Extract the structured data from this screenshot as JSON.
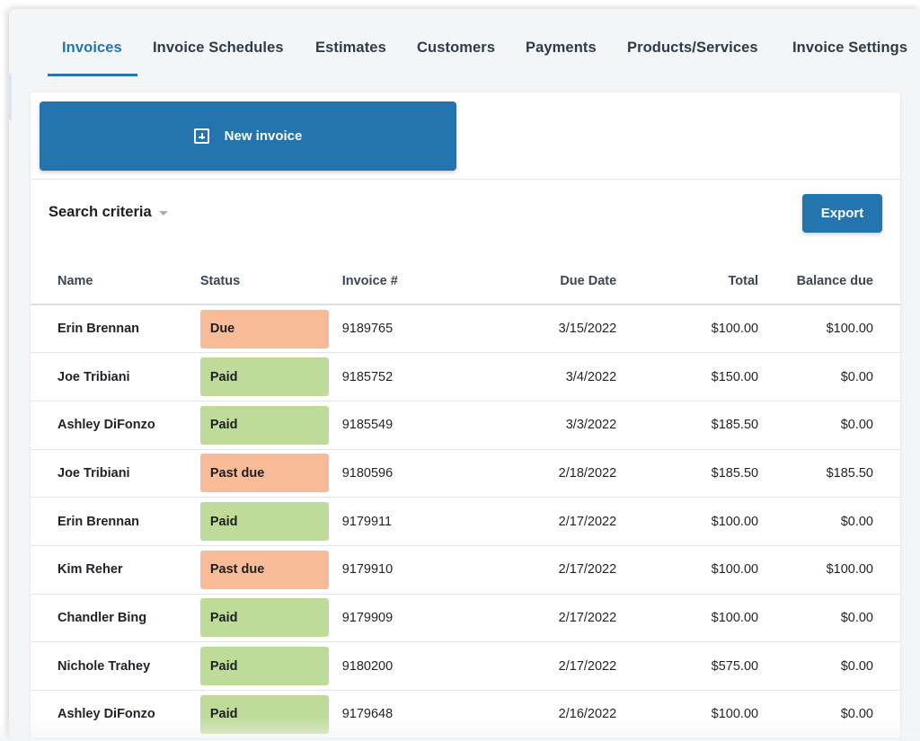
{
  "tabs": [
    {
      "label": "Invoices",
      "active": true
    },
    {
      "label": "Invoice Schedules",
      "active": false
    },
    {
      "label": "Estimates",
      "active": false
    },
    {
      "label": "Customers",
      "active": false
    },
    {
      "label": "Payments",
      "active": false
    },
    {
      "label": "Products/Services",
      "active": false
    },
    {
      "label": "Invoice Settings",
      "active": false
    }
  ],
  "actions": {
    "new_invoice_label": "New invoice",
    "search_criteria_label": "Search criteria",
    "export_label": "Export"
  },
  "colors": {
    "accent": "#2474b0",
    "status_due": "#f8bb98",
    "status_paid": "#bfdb9a"
  },
  "table": {
    "headers": {
      "name": "Name",
      "status": "Status",
      "invoice": "Invoice #",
      "due_date": "Due Date",
      "total": "Total",
      "balance_due": "Balance due"
    },
    "rows": [
      {
        "name": "Erin Brennan",
        "status": "Due",
        "invoice": "9189765",
        "due_date": "3/15/2022",
        "total": "$100.00",
        "balance_due": "$100.00"
      },
      {
        "name": "Joe Tribiani",
        "status": "Paid",
        "invoice": "9185752",
        "due_date": "3/4/2022",
        "total": "$150.00",
        "balance_due": "$0.00"
      },
      {
        "name": "Ashley DiFonzo",
        "status": "Paid",
        "invoice": "9185549",
        "due_date": "3/3/2022",
        "total": "$185.50",
        "balance_due": "$0.00"
      },
      {
        "name": "Joe Tribiani",
        "status": "Past due",
        "invoice": "9180596",
        "due_date": "2/18/2022",
        "total": "$185.50",
        "balance_due": "$185.50"
      },
      {
        "name": "Erin Brennan",
        "status": "Paid",
        "invoice": "9179911",
        "due_date": "2/17/2022",
        "total": "$100.00",
        "balance_due": "$0.00"
      },
      {
        "name": "Kim Reher",
        "status": "Past due",
        "invoice": "9179910",
        "due_date": "2/17/2022",
        "total": "$100.00",
        "balance_due": "$100.00"
      },
      {
        "name": "Chandler Bing",
        "status": "Paid",
        "invoice": "9179909",
        "due_date": "2/17/2022",
        "total": "$100.00",
        "balance_due": "$0.00"
      },
      {
        "name": "Nichole Trahey",
        "status": "Paid",
        "invoice": "9180200",
        "due_date": "2/17/2022",
        "total": "$575.00",
        "balance_due": "$0.00"
      },
      {
        "name": "Ashley DiFonzo",
        "status": "Paid",
        "invoice": "9179648",
        "due_date": "2/16/2022",
        "total": "$100.00",
        "balance_due": "$0.00"
      }
    ]
  }
}
